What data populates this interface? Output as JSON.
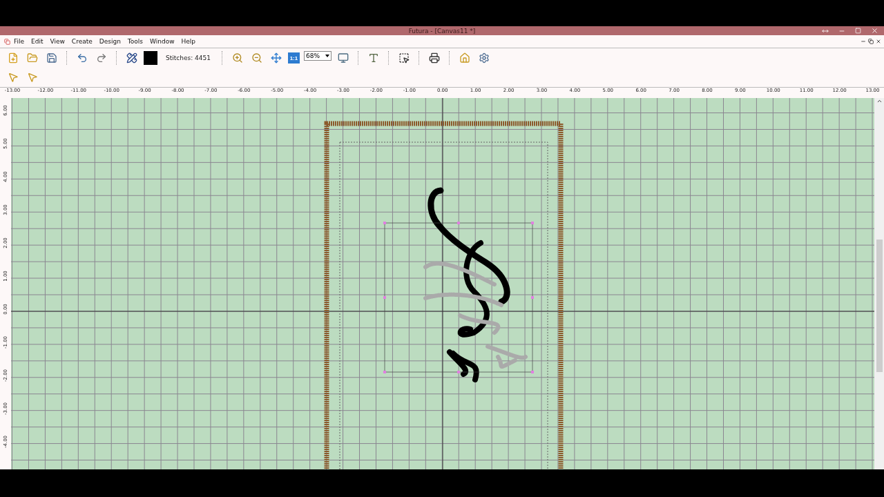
{
  "window": {
    "title": "Futura - [Canvas11 *]"
  },
  "menu": [
    "File",
    "Edit",
    "View",
    "Create",
    "Design",
    "Tools",
    "Window",
    "Help"
  ],
  "toolbar": {
    "stitches": "Stitches: 4451",
    "zoom": "68%",
    "actual_size": "1:1"
  },
  "horizontal_ruler": [
    "-13.00",
    "-12.00",
    "-11.00",
    "-10.00",
    "-9.00",
    "-8.00",
    "-7.00",
    "-6.00",
    "-5.00",
    "-4.00",
    "-3.00",
    "-2.00",
    "-1.00",
    "0.00",
    "1.00",
    "2.00",
    "3.00",
    "4.00",
    "5.00",
    "6.00",
    "7.00",
    "8.00",
    "9.00",
    "10.00",
    "11.00",
    "12.00",
    "13.00"
  ],
  "vertical_ruler": [
    "6.00",
    "5.00",
    "4.00",
    "3.00",
    "2.00",
    "1.00",
    "0.00",
    "-1.00",
    "-2.00",
    "-3.00",
    "-4.00"
  ]
}
